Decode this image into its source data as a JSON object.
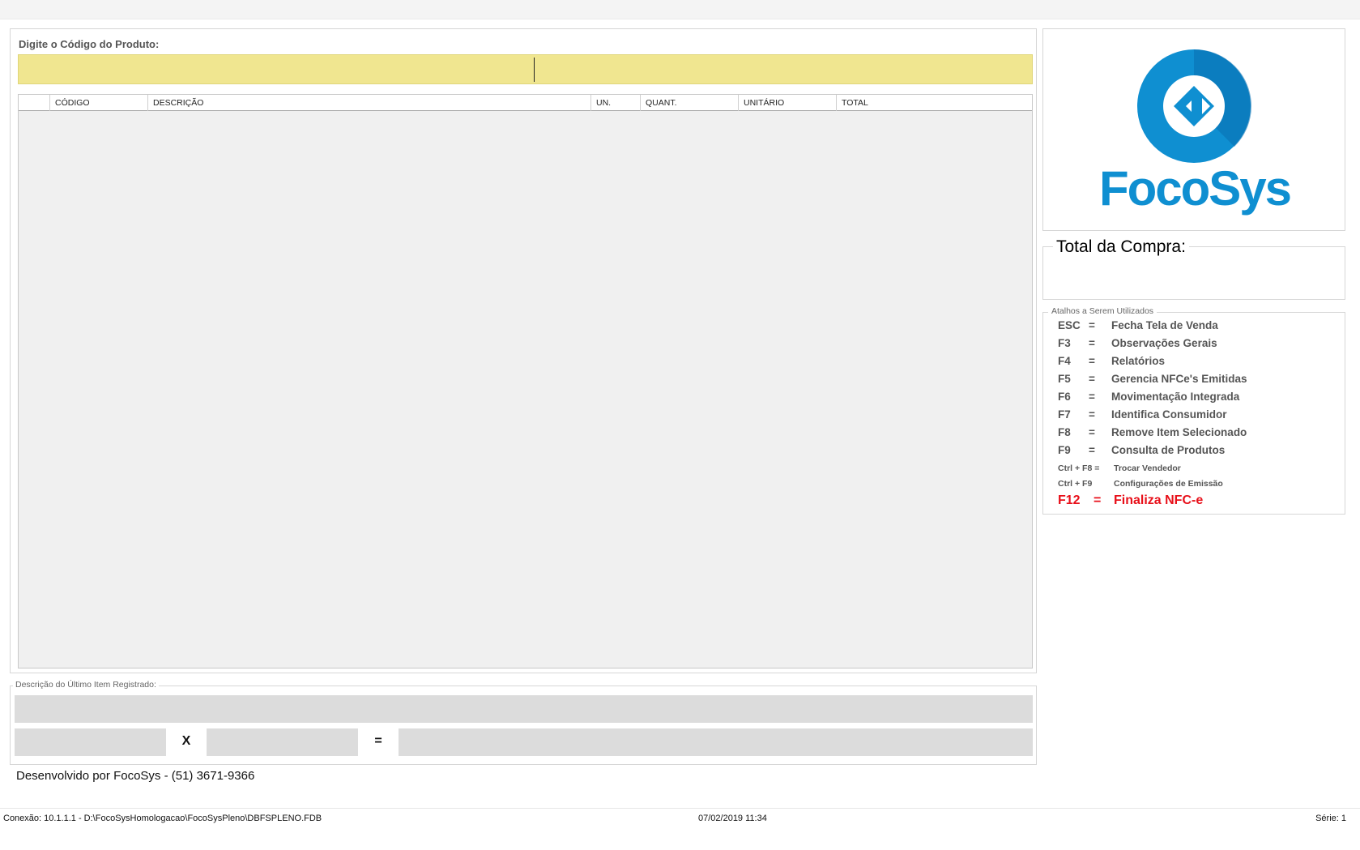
{
  "product_entry": {
    "code_label": "Digite o Código do Produto:",
    "code_value": ""
  },
  "grid": {
    "columns": [
      "",
      "CÓDIGO",
      "DESCRIÇÃO",
      "UN.",
      "QUANT.",
      "UNITÁRIO",
      "TOTAL"
    ],
    "rows": []
  },
  "brand": {
    "name": "FocoSys",
    "logo_color": "#0f8fd1",
    "logo_icon": "code-diamond-icon"
  },
  "total": {
    "label": "Total da Compra:",
    "value": ""
  },
  "shortcuts": {
    "title": "Atalhos a Serem Utilizados",
    "items": [
      {
        "key": "ESC",
        "eq": "=",
        "desc": "Fecha Tela de Venda"
      },
      {
        "key": "F3",
        "eq": "=",
        "desc": "Observações Gerais"
      },
      {
        "key": "F4",
        "eq": "=",
        "desc": "Relatórios"
      },
      {
        "key": "F5",
        "eq": "=",
        "desc": "Gerencia NFCe's Emitidas"
      },
      {
        "key": "F6",
        "eq": "=",
        "desc": "Movimentação Integrada"
      },
      {
        "key": "F7",
        "eq": "=",
        "desc": "Identifica Consumidor"
      },
      {
        "key": "F8",
        "eq": "=",
        "desc": "Remove Item Selecionado"
      },
      {
        "key": "F9",
        "eq": "=",
        "desc": "Consulta de Produtos"
      },
      {
        "key": "Ctrl + F8 =",
        "eq": "",
        "desc": "Trocar Vendedor"
      },
      {
        "key": "Ctrl + F9",
        "eq": "",
        "desc": "Configurações de Emissão"
      },
      {
        "key": "F12",
        "eq": "=",
        "desc": "Finaliza NFC-e"
      }
    ],
    "highlight_color": "#e8101a"
  },
  "last_item": {
    "title": "Descrição do Último Item Registrado:",
    "description": "",
    "quantity": "",
    "times_symbol": "X",
    "unit_price": "",
    "equals_symbol": "=",
    "total": ""
  },
  "footer": {
    "developer": "Desenvolvido por FocoSys - (51) 3671-9366"
  },
  "status_bar": {
    "connection": "Conexão: 10.1.1.1 - D:\\FocoSysHomologacao\\FocoSysPleno\\DBFSPLENO.FDB",
    "datetime": "07/02/2019 11:34",
    "series": "Série: 1"
  }
}
